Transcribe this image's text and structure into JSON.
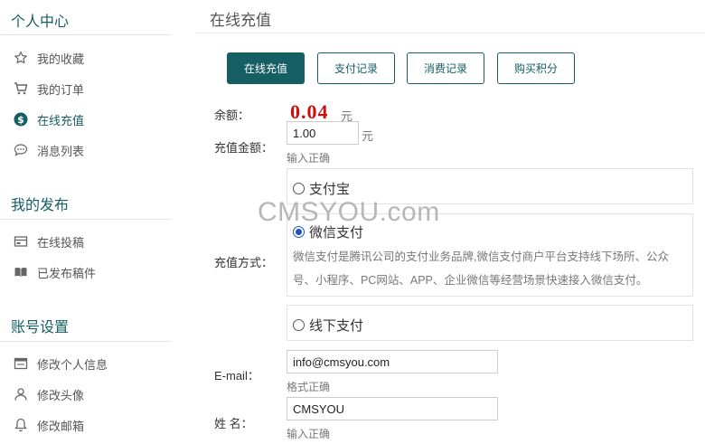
{
  "sidebar": {
    "sections": [
      {
        "heading": "个人中心",
        "items": [
          {
            "label": "我的收藏",
            "icon": "star-icon"
          },
          {
            "label": "我的订单",
            "icon": "cart-icon"
          },
          {
            "label": "在线充值",
            "icon": "dollar-circle-icon",
            "active": true
          },
          {
            "label": "消息列表",
            "icon": "chat-bubble-icon"
          }
        ]
      },
      {
        "heading": "我的发布",
        "items": [
          {
            "label": "在线投稿",
            "icon": "card-icon"
          },
          {
            "label": "已发布稿件",
            "icon": "book-icon"
          }
        ]
      },
      {
        "heading": "账号设置",
        "items": [
          {
            "label": "修改个人信息",
            "icon": "window-icon"
          },
          {
            "label": "修改头像",
            "icon": "user-icon"
          },
          {
            "label": "修改邮箱",
            "icon": "bell-icon"
          }
        ]
      }
    ]
  },
  "main": {
    "title": "在线充值",
    "tabs": [
      {
        "label": "在线充值",
        "active": true
      },
      {
        "label": "支付记录",
        "active": false
      },
      {
        "label": "消费记录",
        "active": false
      },
      {
        "label": "购买积分",
        "active": false
      }
    ],
    "form": {
      "balance_label": "余额：",
      "balance_value": "0.04",
      "balance_unit": "元",
      "amount_label": "充值金额：",
      "amount_value": "1.00",
      "amount_unit": "元",
      "amount_hint": "输入正确",
      "method_label": "充值方式：",
      "methods": [
        {
          "label": "支付宝",
          "checked": false
        },
        {
          "label": "微信支付",
          "checked": true,
          "description": "微信支付是腾讯公司的支付业务品牌,微信支付商户平台支持线下场所、公众号、小程序、PC网站、APP、企业微信等经营场景快速接入微信支付。"
        },
        {
          "label": "线下支付",
          "checked": false
        }
      ],
      "email_label": "E-mail：",
      "email_value": "info@cmsyou.com",
      "email_hint": "格式正确",
      "name_label": "姓 名：",
      "name_value": "CMSYOU",
      "name_hint": "输入正确"
    }
  },
  "watermark": "CMSYOU.com",
  "colors": {
    "accent": "#155e63",
    "balance": "#cc1010",
    "radio_checked": "#1a55c8"
  }
}
